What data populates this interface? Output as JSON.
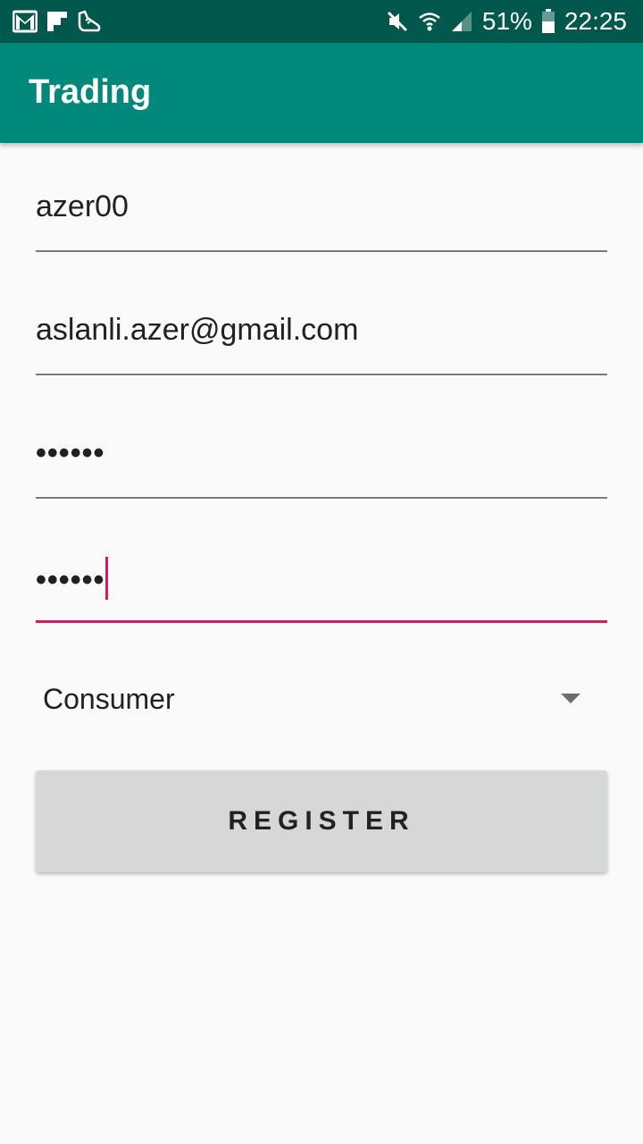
{
  "status_bar": {
    "left_icons": [
      "gmail-icon",
      "flipboard-icon",
      "sneaker-icon"
    ],
    "right_icons": [
      "mute-icon",
      "wifi-icon",
      "signal-icon",
      "battery-icon"
    ],
    "battery_percent": "51%",
    "clock": "22:25"
  },
  "appbar": {
    "title": "Trading"
  },
  "form": {
    "username_value": "azer00",
    "email_value": "aslanli.azer@gmail.com",
    "password_value": "••••••",
    "confirm_password_value": "••••••",
    "role_selected": "Consumer",
    "register_label": "REGISTER"
  },
  "colors": {
    "status_bar": "#00574b",
    "app_bar": "#00897b",
    "accent": "#d81b60",
    "button": "#d6d7d7"
  }
}
